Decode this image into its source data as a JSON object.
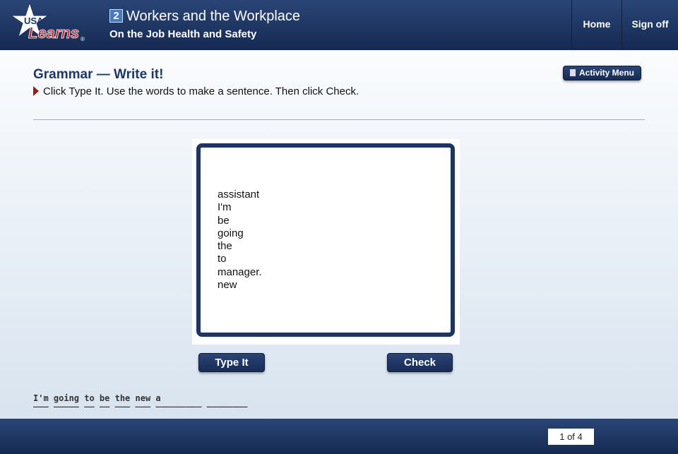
{
  "header": {
    "logo_text": "USA Learns",
    "unit_number": "2",
    "unit_title": "Workers and the Workplace",
    "lesson_title": "On the Job Health and Safety",
    "nav": [
      {
        "label": "Home"
      },
      {
        "label": "Sign off"
      }
    ]
  },
  "activity": {
    "title": "Grammar — Write it!",
    "instruction": "Click Type It. Use the words to make a sentence. Then click Check.",
    "menu_label": "Activity Menu",
    "words": [
      "assistant",
      "I'm",
      "be",
      "going",
      "the",
      "to",
      "manager.",
      "new"
    ],
    "type_label": "Type It",
    "check_label": "Check",
    "typed_text": "I'm going to be the new a",
    "blanks": "___ _____ __ __ ___ ___ _________ ________"
  },
  "footer": {
    "page": "1 of 4"
  },
  "colors": {
    "navy": "#1a3566",
    "accent_red": "#9b1b1b"
  }
}
